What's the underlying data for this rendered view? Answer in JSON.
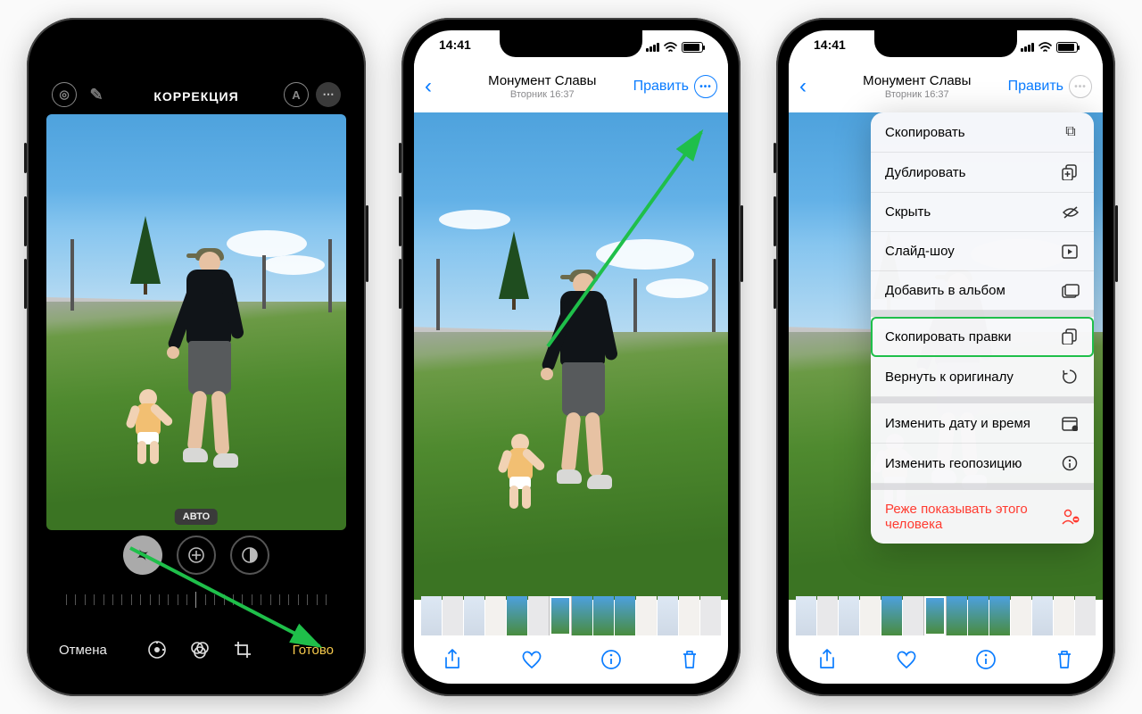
{
  "phone1": {
    "title": "КОРРЕКЦИЯ",
    "auto_badge": "АВТО",
    "cancel": "Отмена",
    "done": "Готово",
    "top_icons": {
      "live": "live-photo-icon",
      "pen": "markup-pen-icon",
      "aspect": "aspect-icon",
      "more": "more-icon"
    }
  },
  "phone2": {
    "time": "14:41",
    "title": "Монумент Славы",
    "subtitle": "Вторник 16:37",
    "edit": "Править"
  },
  "phone3": {
    "time": "14:41",
    "title": "Монумент Славы",
    "subtitle": "Вторник 16:37",
    "edit": "Править",
    "menu": {
      "copy": "Скопировать",
      "duplicate": "Дублировать",
      "hide": "Скрыть",
      "slideshow": "Слайд-шоу",
      "add_album": "Добавить в альбом",
      "copy_edits": "Скопировать правки",
      "revert": "Вернуть к оригиналу",
      "change_date": "Изменить дату и время",
      "change_location": "Изменить геопозицию",
      "feature_less": "Реже показывать этого человека"
    }
  }
}
